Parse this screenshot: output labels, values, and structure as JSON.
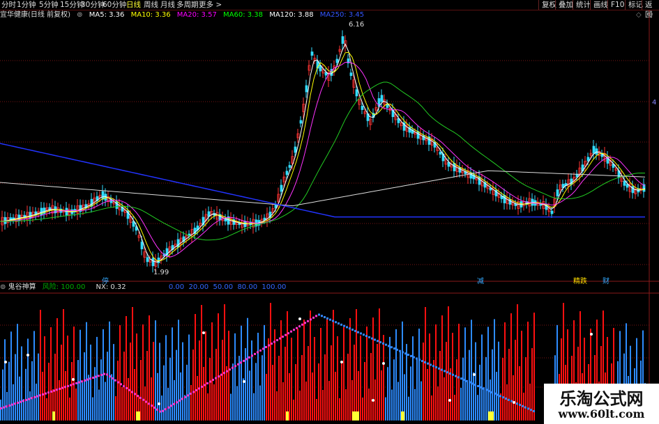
{
  "periods": [
    {
      "label": "分时"
    },
    {
      "label": "1分钟"
    },
    {
      "label": "5分钟"
    },
    {
      "label": "15分钟"
    },
    {
      "label": "30分钟"
    },
    {
      "label": "60分钟"
    },
    {
      "label": "日线",
      "active": true
    },
    {
      "label": "周线"
    },
    {
      "label": "月线"
    },
    {
      "label": "多周期"
    },
    {
      "label": "更多 >"
    }
  ],
  "toolbar_right": [
    "复权",
    "叠加",
    "统计",
    "画线",
    "F10",
    "标记",
    "返回"
  ],
  "stock": {
    "title": "宜华健康(日线 前复权)"
  },
  "ma": [
    {
      "label": "MA5: 3.36",
      "color": "#ffffff"
    },
    {
      "label": "MA10: 3.36",
      "color": "#ffff00"
    },
    {
      "label": "MA20: 3.57",
      "color": "#ff00ff"
    },
    {
      "label": "MA60: 3.38",
      "color": "#00ff00"
    },
    {
      "label": "MA120: 3.88",
      "color": "#ffffff"
    },
    {
      "label": "MA250: 3.45",
      "color": "#3344ff"
    }
  ],
  "price_labels": {
    "high": "6.16",
    "low": "1.99",
    "right_mark": "4"
  },
  "event_markers": [
    "停",
    "减",
    "精跌",
    "财"
  ],
  "indicator": {
    "name": "鬼谷神算",
    "risk": "风险: 100.00",
    "nx": "NX: 0.32",
    "levels": "0.00  20.00  50.00  80.00  100.00"
  },
  "watermark": {
    "title": "乐淘公式网",
    "url": "www.60lt.com"
  },
  "colors": {
    "up": "#ff3333",
    "down": "#33ddff",
    "grid": "#7a1515",
    "hist_red": "#ff1010",
    "hist_blue": "#2d8cff"
  }
}
